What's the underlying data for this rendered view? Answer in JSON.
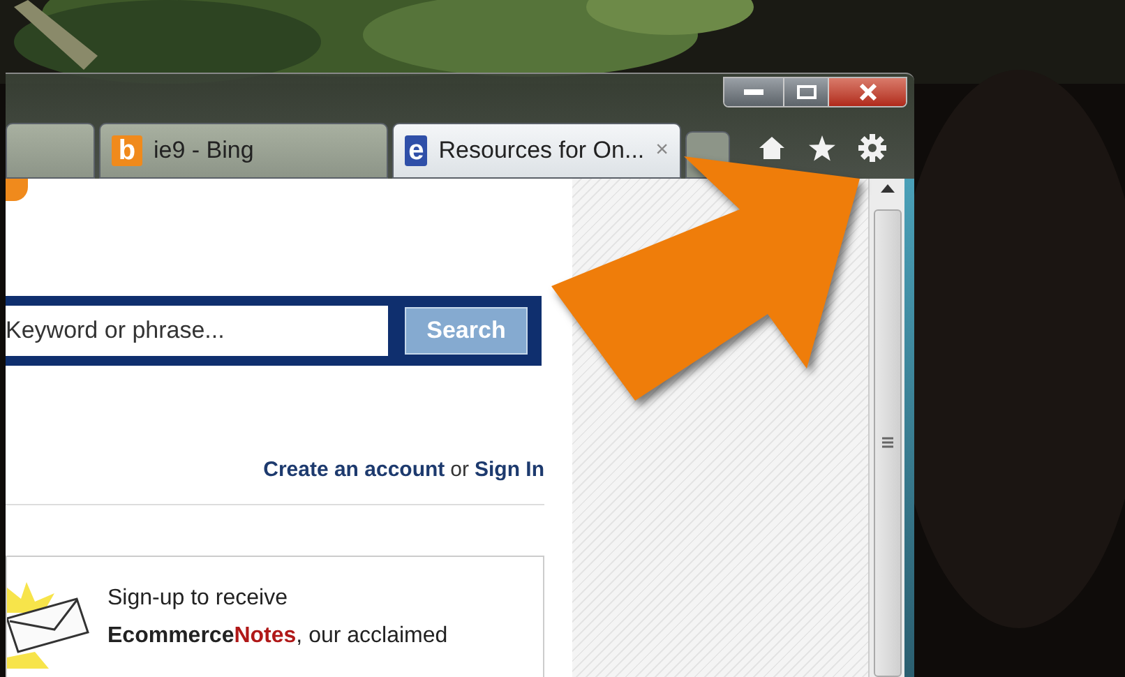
{
  "tabs": [
    {
      "selected": false
    },
    {
      "label": "ie9 - Bing",
      "favicon": {
        "glyph": "b",
        "color": "#f08a1c"
      },
      "selected": false
    },
    {
      "label": "Resources for On...",
      "favicon": {
        "glyph": "e",
        "color": "#2f4fa8"
      },
      "selected": true,
      "close": "×"
    }
  ],
  "page": {
    "search": {
      "placeholder": "Keyword or phrase...",
      "button": "Search"
    },
    "account": {
      "create": "Create an account",
      "separator": "or",
      "sign_in": "Sign In"
    },
    "newsletter": {
      "intro": "Sign-up to receive",
      "brand_a": "Ecommerce",
      "brand_b": "Notes",
      "rest": ", our acclaimed"
    }
  }
}
